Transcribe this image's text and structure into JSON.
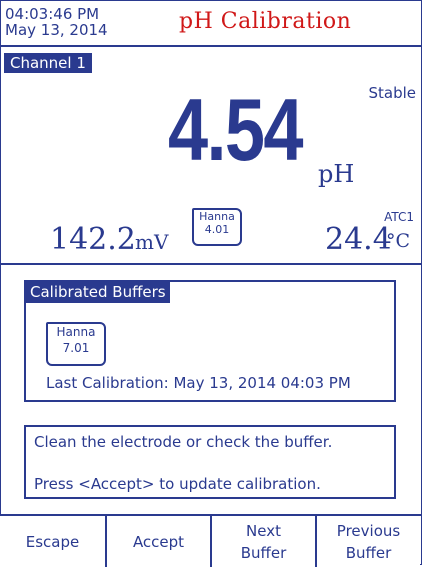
{
  "header": {
    "time": "04:03:46 PM",
    "date": "May 13, 2014",
    "title": "pH Calibration"
  },
  "channel": "Channel 1",
  "measurement": {
    "status": "Stable",
    "value": "4.54",
    "unit": "pH",
    "mv_value": "142.2",
    "mv_unit": "mV",
    "buffer_badge": {
      "brand": "Hanna",
      "value": "4.01"
    },
    "atc": "ATC1",
    "temp_value": "24.4",
    "temp_unit": "°C"
  },
  "calibrated_buffers": {
    "heading": "Calibrated Buffers",
    "badge": {
      "brand": "Hanna",
      "value": "7.01"
    },
    "last_calibration": "Last Calibration: May 13, 2014  04:03 PM"
  },
  "messages": {
    "line1": "Clean the electrode or check the buffer.",
    "line2": "Press <Accept> to update calibration."
  },
  "softkeys": {
    "escape": "Escape",
    "accept": "Accept",
    "next_buffer": "Next\nBuffer",
    "previous_buffer": "Previous\nBuffer"
  },
  "colors": {
    "primary": "#2a3a8f",
    "title_red": "#d01818",
    "background": "#ffffff"
  }
}
